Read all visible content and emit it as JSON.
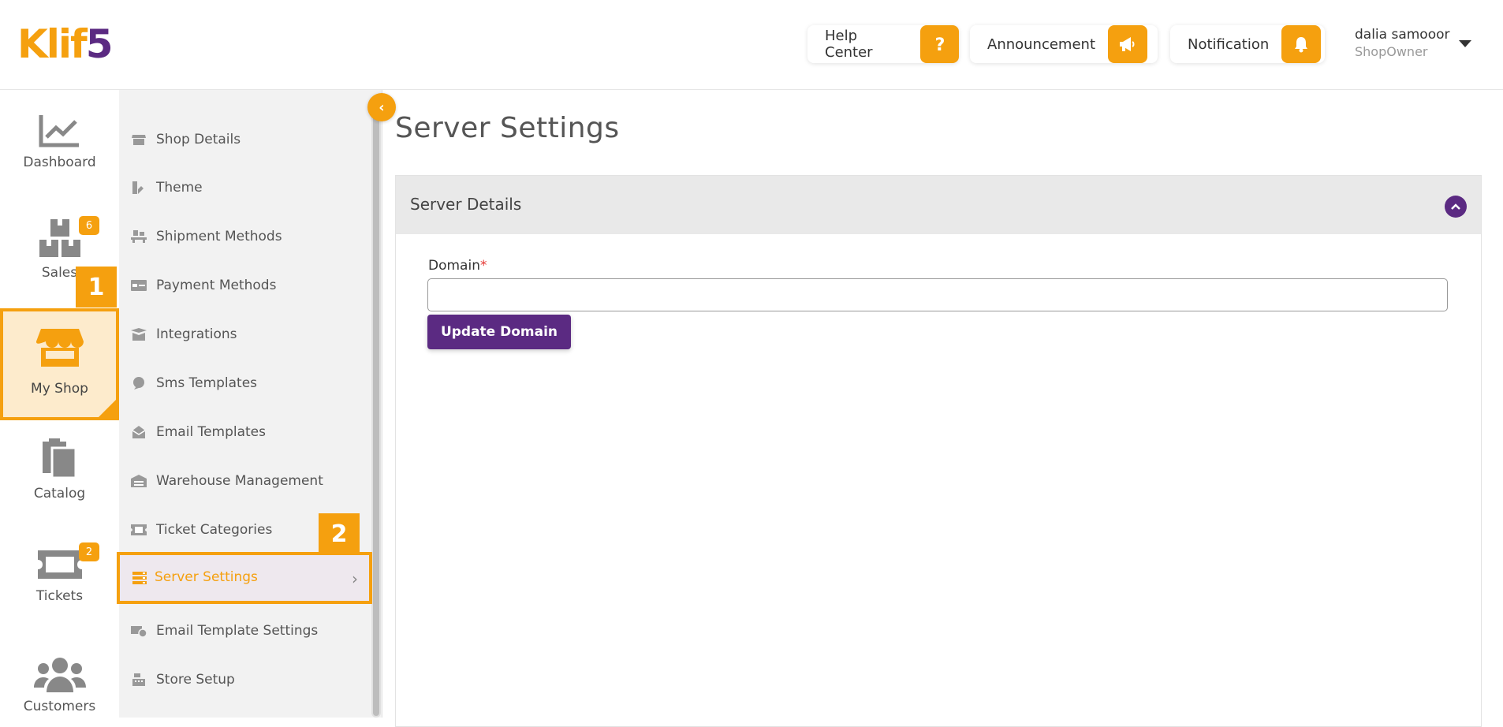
{
  "brand": {
    "logo_main": "Klif",
    "logo_accent": "5",
    "colors": {
      "accent": "#f5a00f",
      "primary": "#5b2a82"
    }
  },
  "header": {
    "help_center": {
      "label": "Help Center",
      "icon": "question-icon"
    },
    "announcement": {
      "label": "Announcement",
      "icon": "megaphone-icon"
    },
    "notification": {
      "label": "Notification",
      "icon": "bell-icon"
    },
    "user": {
      "name": "dalia samooor",
      "role": "ShopOwner"
    }
  },
  "leftnav": {
    "items": [
      {
        "label": "Dashboard",
        "icon": "chart-icon"
      },
      {
        "label": "Sales",
        "icon": "boxes-icon",
        "badge": "6"
      },
      {
        "label": "My Shop",
        "icon": "shop-icon"
      },
      {
        "label": "Catalog",
        "icon": "clipboard-icon"
      },
      {
        "label": "Tickets",
        "icon": "ticket-icon",
        "badge": "2"
      },
      {
        "label": "Customers",
        "icon": "users-icon"
      }
    ]
  },
  "callouts": {
    "one": "1",
    "two": "2"
  },
  "subnav": {
    "items": [
      {
        "label": "Shop Details"
      },
      {
        "label": "Theme"
      },
      {
        "label": "Shipment Methods"
      },
      {
        "label": "Payment Methods"
      },
      {
        "label": "Integrations"
      },
      {
        "label": "Sms Templates"
      },
      {
        "label": "Email Templates"
      },
      {
        "label": "Warehouse Management"
      },
      {
        "label": "Ticket Categories"
      },
      {
        "label": "Server Settings"
      },
      {
        "label": "Email Template Settings"
      },
      {
        "label": "Store Setup"
      }
    ]
  },
  "main": {
    "title": "Server Settings",
    "panel_title": "Server Details",
    "domain_label": "Domain",
    "domain_required": "*",
    "domain_value": "",
    "update_button": "Update Domain"
  }
}
